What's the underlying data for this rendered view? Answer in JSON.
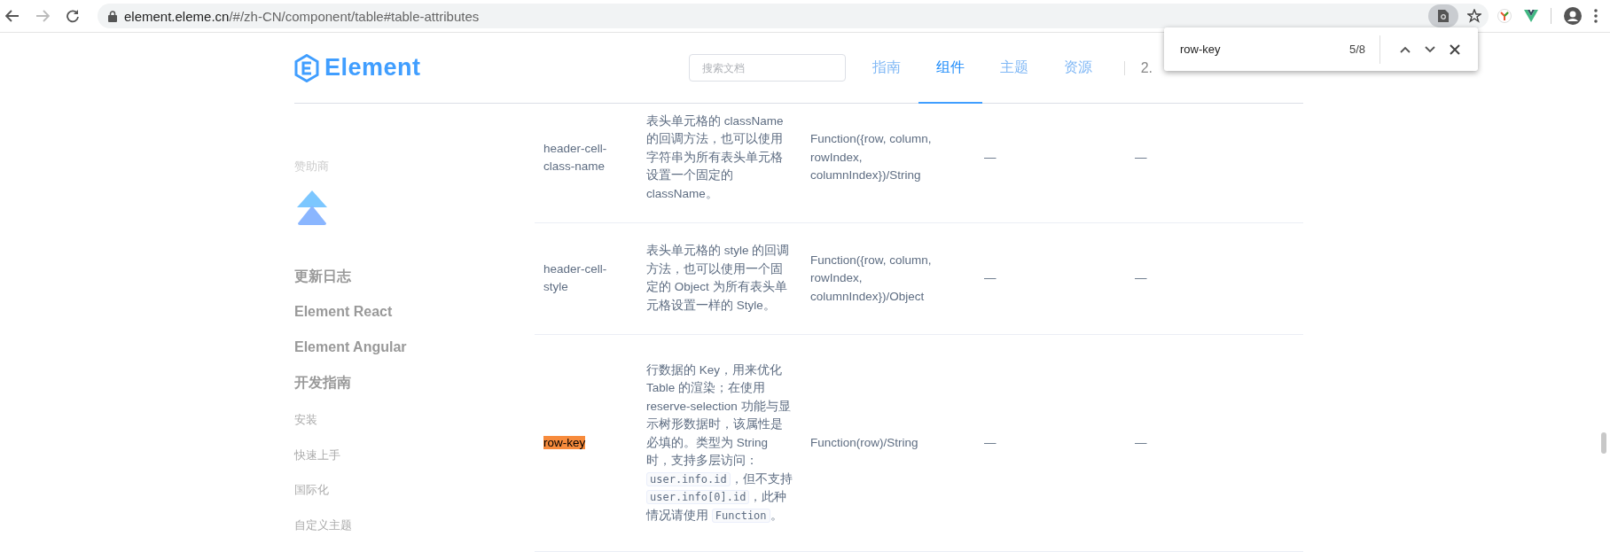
{
  "browser": {
    "url_host": "element.eleme.cn",
    "url_path": "/#/zh-CN/component/table#table-attributes",
    "back_disabled": false,
    "forward_disabled": true
  },
  "find_bar": {
    "query": "row-key",
    "count": "5/8"
  },
  "header": {
    "logo_text": "Element",
    "search": {
      "placeholder": "搜索文档"
    },
    "nav": [
      {
        "label": "指南",
        "selected": false
      },
      {
        "label": "组件",
        "selected": true
      },
      {
        "label": "主题",
        "selected": false
      },
      {
        "label": "资源",
        "selected": false
      }
    ],
    "version": "2."
  },
  "sidebar": {
    "sponsor_label": "赞助商",
    "items": [
      {
        "label": "更新日志",
        "kind": "heading"
      },
      {
        "label": "Element React",
        "kind": "heading"
      },
      {
        "label": "Element Angular",
        "kind": "heading"
      },
      {
        "label": "开发指南",
        "kind": "heading"
      },
      {
        "label": "安装",
        "kind": "link"
      },
      {
        "label": "快速上手",
        "kind": "link"
      },
      {
        "label": "国际化",
        "kind": "link"
      },
      {
        "label": "自定义主题",
        "kind": "link"
      }
    ]
  },
  "table": {
    "rows": [
      {
        "name": "header-cell-class-name",
        "highlighted": false,
        "description": [
          {
            "kind": "text",
            "text": "表头单元格的 className 的回调方法，也可以使用字符串为所有表头单元格设置一个固定的 className。"
          }
        ],
        "type": "Function({row, column, rowIndex, columnIndex})/String",
        "options": "—",
        "default": "—"
      },
      {
        "name": "header-cell-style",
        "highlighted": false,
        "description": [
          {
            "kind": "text",
            "text": "表头单元格的 style 的回调方法，也可以使用一个固定的 Object 为所有表头单元格设置一样的 Style。"
          }
        ],
        "type": "Function({row, column, rowIndex, columnIndex})/Object",
        "options": "—",
        "default": "—"
      },
      {
        "name": "row-key",
        "highlighted": true,
        "description": [
          {
            "kind": "text",
            "text": "行数据的 Key，用来优化 Table 的渲染；在使用 reserve-selection 功能与显示树形数据时，该属性是必填的。类型为 String 时，支持多层访问："
          },
          {
            "kind": "code",
            "text": "user.info.id"
          },
          {
            "kind": "text",
            "text": "，但不支持 "
          },
          {
            "kind": "code",
            "text": "user.info[0].id"
          },
          {
            "kind": "text",
            "text": "，此种情况请使用 "
          },
          {
            "kind": "code",
            "text": "Function"
          },
          {
            "kind": "text",
            "text": "。"
          }
        ],
        "type": "Function(row)/String",
        "options": "—",
        "default": "—"
      }
    ]
  }
}
